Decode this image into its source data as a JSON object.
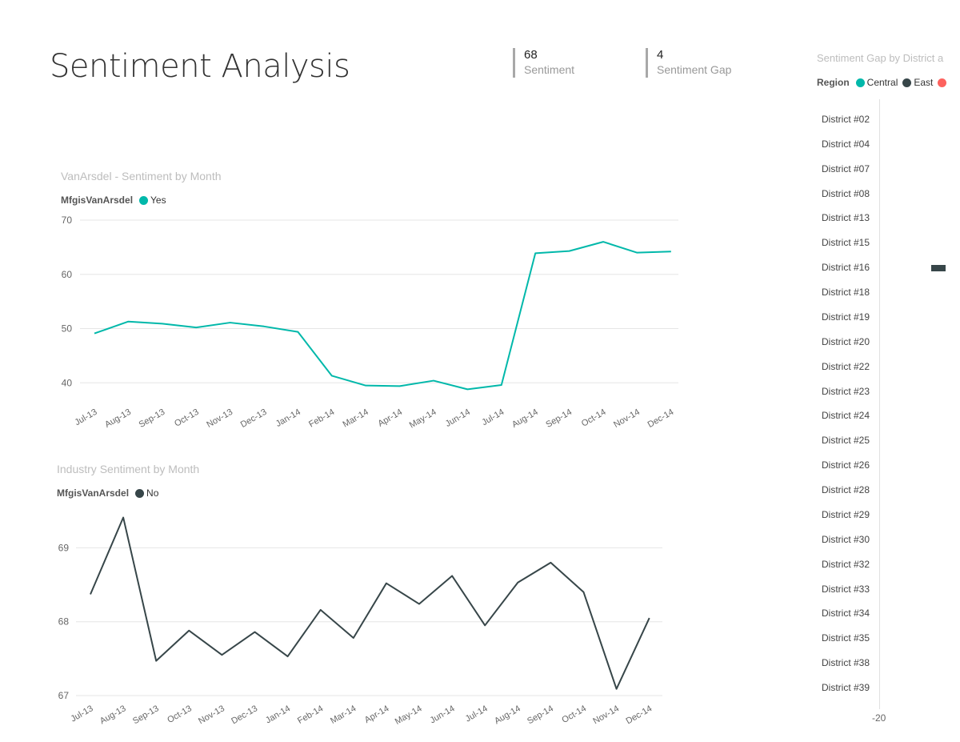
{
  "page": {
    "title": "Sentiment Analysis"
  },
  "kpis": [
    {
      "value": "68",
      "label": "Sentiment"
    },
    {
      "value": "4",
      "label": "Sentiment Gap"
    }
  ],
  "colors": {
    "teal": "#01B8AA",
    "dark": "#374649",
    "red": "#FD625E",
    "grid": "#e6e6e6",
    "axis_text": "#666666"
  },
  "chart_data": [
    {
      "type": "line",
      "title": "VanArsdel - Sentiment by Month",
      "legend": {
        "title": "MfgisVanArsdel",
        "entries": [
          {
            "name": "Yes",
            "color": "#01B8AA"
          }
        ],
        "position": "top-left"
      },
      "categories": [
        "Jul-13",
        "Aug-13",
        "Sep-13",
        "Oct-13",
        "Nov-13",
        "Dec-13",
        "Jan-14",
        "Feb-14",
        "Mar-14",
        "Apr-14",
        "May-14",
        "Jun-14",
        "Jul-14",
        "Aug-14",
        "Sep-14",
        "Oct-14",
        "Nov-14",
        "Dec-14"
      ],
      "series": [
        {
          "name": "Yes",
          "values": [
            49.1,
            51.3,
            50.9,
            50.2,
            51.1,
            50.4,
            49.4,
            41.3,
            39.5,
            39.4,
            40.4,
            38.8,
            39.6,
            63.9,
            64.3,
            66.0,
            64.0,
            64.2
          ]
        }
      ],
      "ylim": [
        37,
        70
      ],
      "yticks": [
        40,
        50,
        60,
        70
      ],
      "grid": true
    },
    {
      "type": "line",
      "title": "Industry Sentiment by Month",
      "legend": {
        "title": "MfgisVanArsdel",
        "entries": [
          {
            "name": "No",
            "color": "#374649"
          }
        ],
        "position": "top-left"
      },
      "categories": [
        "Jul-13",
        "Aug-13",
        "Sep-13",
        "Oct-13",
        "Nov-13",
        "Dec-13",
        "Jan-14",
        "Feb-14",
        "Mar-14",
        "Apr-14",
        "May-14",
        "Jun-14",
        "Jul-14",
        "Aug-14",
        "Sep-14",
        "Oct-14",
        "Nov-14",
        "Dec-14"
      ],
      "series": [
        {
          "name": "No",
          "values": [
            68.37,
            69.41,
            67.47,
            67.88,
            67.55,
            67.86,
            67.53,
            68.16,
            67.78,
            68.52,
            68.24,
            68.62,
            67.95,
            68.53,
            68.8,
            68.4,
            67.09,
            68.05
          ]
        }
      ],
      "ylim": [
        67,
        69.6
      ],
      "yticks": [
        67,
        68,
        69
      ],
      "grid": true
    },
    {
      "type": "bar",
      "orientation": "horizontal",
      "title": "Sentiment Gap by District a",
      "legend": {
        "title": "Region",
        "entries": [
          {
            "name": "Central",
            "color": "#01B8AA"
          },
          {
            "name": "East",
            "color": "#374649"
          },
          {
            "name": "",
            "color": "#FD625E"
          }
        ],
        "position": "top-left"
      },
      "categories": [
        "District #02",
        "District #04",
        "District #07",
        "District #08",
        "District #13",
        "District #15",
        "District #16",
        "District #18",
        "District #19",
        "District #20",
        "District #22",
        "District #23",
        "District #24",
        "District #25",
        "District #26",
        "District #28",
        "District #29",
        "District #30",
        "District #32",
        "District #33",
        "District #34",
        "District #35",
        "District #38",
        "District #39"
      ],
      "xticks": [
        -20
      ],
      "grid": false
    }
  ]
}
